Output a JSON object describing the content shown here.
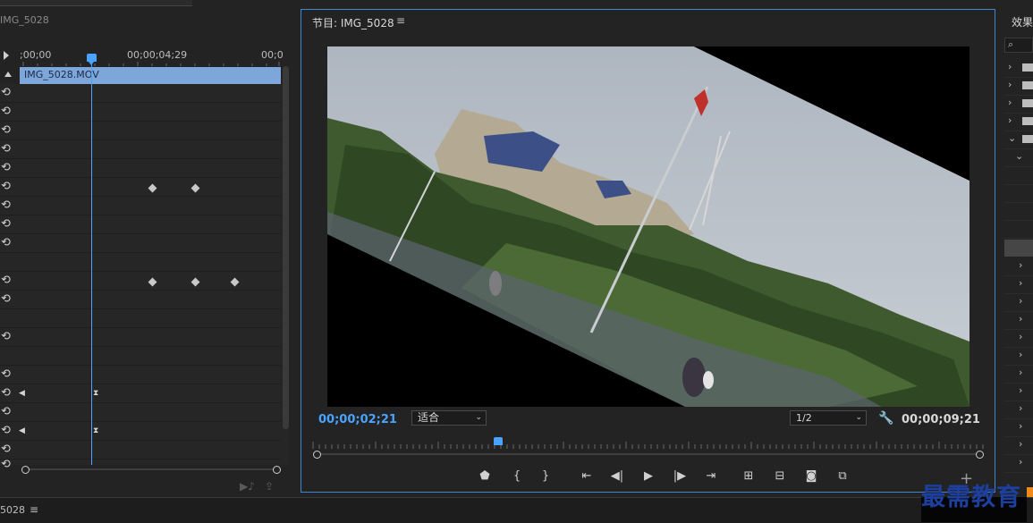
{
  "effect_controls": {
    "panel_title": "IMG_5028",
    "ruler_labels": [
      ";00;00",
      "00;00;04;29",
      "00;0"
    ],
    "clip_name": "IMG_5028.MOV"
  },
  "program_monitor": {
    "title": "节目: IMG_5028",
    "current_timecode": "00;00;02;21",
    "fit_label": "适合",
    "resolution_label": "1/2",
    "duration_timecode": "00;00;09;21"
  },
  "effects_panel": {
    "title": "效果"
  },
  "bottom_panel": {
    "title": "5028"
  },
  "watermark": "最需教育",
  "colors": {
    "accent_blue": "#4aa3ff",
    "clip_bar": "#7da6db",
    "watermark": "#1d3f9e"
  }
}
